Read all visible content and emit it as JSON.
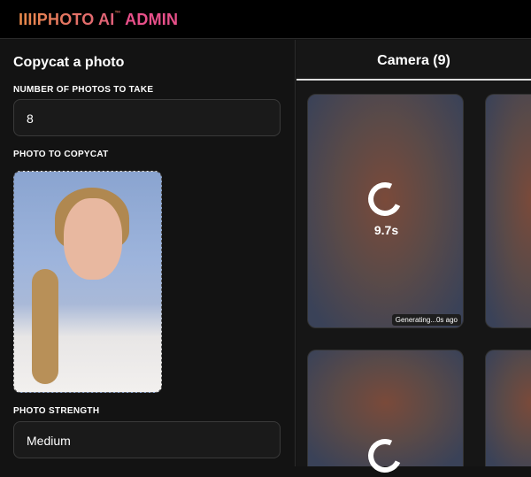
{
  "header": {
    "logo_main": "IIIIPHOTO AI",
    "logo_tm": "™",
    "logo_admin": "ADMIN"
  },
  "form": {
    "title": "Copycat a photo",
    "num_photos_label": "NUMBER OF PHOTOS TO TAKE",
    "num_photos_value": "8",
    "photo_label": "PHOTO TO COPYCAT",
    "strength_label": "PHOTO STRENGTH",
    "strength_value": "Medium"
  },
  "camera": {
    "title": "Camera (9)",
    "cards": [
      {
        "timer": "9.7s",
        "status": "Generating...0s ago"
      }
    ]
  }
}
